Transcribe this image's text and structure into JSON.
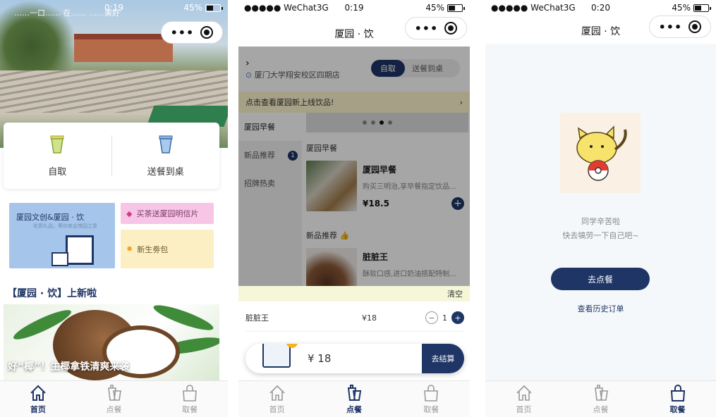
{
  "screens": {
    "home": {
      "status": {
        "signal": "",
        "time": "0:19",
        "battery": "45%"
      },
      "hero_marquee": "……一口…… 在…… ……美好",
      "modes": [
        {
          "label": "自取",
          "icon": "cup-icon"
        },
        {
          "label": "送餐到桌",
          "icon": "cup-icon"
        }
      ],
      "promo": {
        "big_title": "厦园文创&厦园 · 饮",
        "big_sub": "优质礼品，等你来会馆园之意",
        "pink": "买茶送厦园明信片",
        "yellow": "新生劵包"
      },
      "new_title": "【厦园 · 饮】上新啦",
      "coconut_caption": "好“椰”！生椰拿铁清爽来袭"
    },
    "order": {
      "status": {
        "signal": "●●●●● WeChat3G",
        "time": "0:19",
        "battery": "45%"
      },
      "title": "厦园 · 饮",
      "location": "厦门大学翔安校区四期店",
      "mode_on": "自取",
      "mode_off": "送餐到桌",
      "notice": "点击查看厦园新上线饮品!",
      "categories": [
        {
          "label": "厦园早餐",
          "badge": ""
        },
        {
          "label": "新品推荐",
          "badge": "1"
        },
        {
          "label": "招牌热卖",
          "badge": ""
        }
      ],
      "section1": "厦园早餐",
      "item1": {
        "name": "厦园早餐",
        "desc": "购买三明治,享早餐指定饮品...",
        "price": "¥18.5"
      },
      "section2": "新品推荐",
      "item2": {
        "name": "脏脏王",
        "desc": "酥软口感,进口奶油搭配特制..."
      },
      "clear": "清空",
      "cart_item": {
        "name": "脏脏王",
        "price": "¥18",
        "qty": "1"
      },
      "cart_count": "1",
      "total": "¥ 18",
      "checkout": "去结算"
    },
    "pickup": {
      "status": {
        "signal": "●●●●● WeChat3G",
        "time": "0:20",
        "battery": "45%"
      },
      "title": "厦园 · 饮",
      "msg1": "同学辛苦啦",
      "msg2": "快去犒劳一下自己吧~",
      "button": "去点餐",
      "history": "查看历史订单"
    }
  },
  "tabbar": [
    {
      "label": "首页",
      "icon": "home-icon"
    },
    {
      "label": "点餐",
      "icon": "drinks-icon"
    },
    {
      "label": "取餐",
      "icon": "bag-icon"
    }
  ],
  "colors": {
    "brand": "#1e3566",
    "badge": "#f5b21a"
  }
}
